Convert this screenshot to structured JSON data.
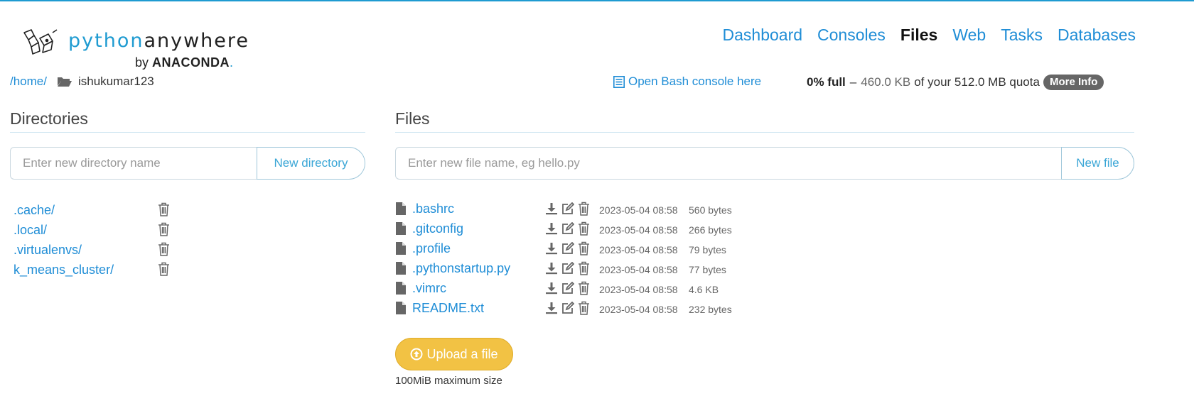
{
  "brand": {
    "name_part1": "python",
    "name_part2": "anywhere",
    "by_prefix": "by",
    "by_name": "ANACONDA",
    "by_suffix": ".",
    "accent_color": "#1f9bd1"
  },
  "nav": {
    "items": [
      {
        "label": "Dashboard",
        "active": false
      },
      {
        "label": "Consoles",
        "active": false
      },
      {
        "label": "Files",
        "active": true
      },
      {
        "label": "Web",
        "active": false
      },
      {
        "label": "Tasks",
        "active": false
      },
      {
        "label": "Databases",
        "active": false
      }
    ]
  },
  "breadcrumb": {
    "root_link": "/home/",
    "current": "ishukumar123",
    "folder_icon": "folder-open-icon"
  },
  "bash": {
    "label": "Open Bash console here",
    "icon": "console-list-icon"
  },
  "quota": {
    "full": "0% full",
    "dash": "–",
    "used": "460.0 KB",
    "rest": "of your 512.0 MB quota",
    "more_info": "More Info"
  },
  "directories": {
    "title": "Directories",
    "input_placeholder": "Enter new directory name",
    "button": "New directory",
    "items": [
      {
        "name": ".cache/"
      },
      {
        "name": ".local/"
      },
      {
        "name": ".virtualenvs/"
      },
      {
        "name": "k_means_cluster/"
      }
    ]
  },
  "files": {
    "title": "Files",
    "input_placeholder": "Enter new file name, eg hello.py",
    "button": "New file",
    "items": [
      {
        "name": ".bashrc",
        "date": "2023-05-04 08:58",
        "size": "560 bytes"
      },
      {
        "name": ".gitconfig",
        "date": "2023-05-04 08:58",
        "size": "266 bytes"
      },
      {
        "name": ".profile",
        "date": "2023-05-04 08:58",
        "size": "79 bytes"
      },
      {
        "name": ".pythonstartup.py",
        "date": "2023-05-04 08:58",
        "size": "77 bytes"
      },
      {
        "name": ".vimrc",
        "date": "2023-05-04 08:58",
        "size": "4.6 KB"
      },
      {
        "name": "README.txt",
        "date": "2023-05-04 08:58",
        "size": "232 bytes"
      }
    ]
  },
  "upload": {
    "label": "Upload a file",
    "note": "100MiB maximum size"
  }
}
